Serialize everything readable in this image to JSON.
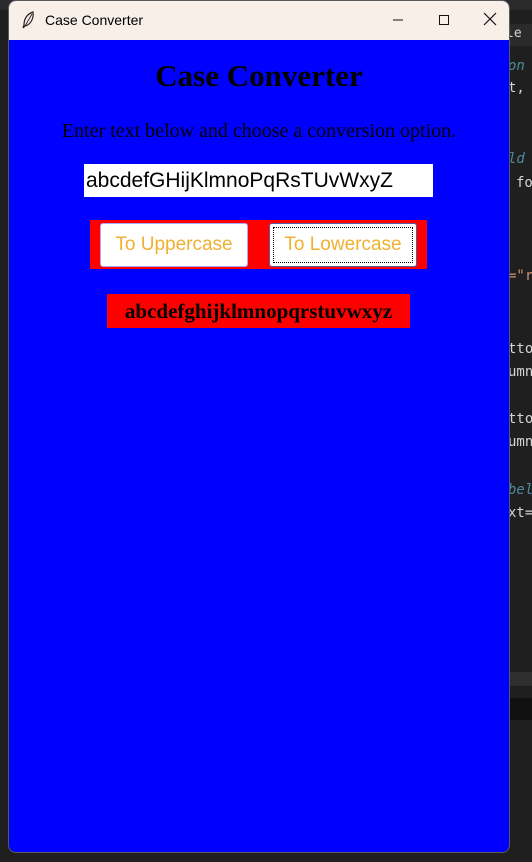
{
  "window": {
    "title": "Case Converter",
    "icon": "feather-icon",
    "controls": [
      "minimize-icon",
      "maximize-icon",
      "close-icon"
    ]
  },
  "app": {
    "heading": "Case Converter",
    "instructions": "Enter text below and choose a conversion option.",
    "input_value": "abcdefGHijKlmnoPqRsTUvWxyZ",
    "upper_button": "To Uppercase",
    "lower_button": "To Lowercase",
    "result": "abcdefghijklmnopqrstuvwxyz"
  },
  "background_editor": {
    "tab_text": "le",
    "lines": [
      {
        "text": "on",
        "style": "comment"
      },
      {
        "text": "t,",
        "style": "code"
      },
      {
        "text": "ld",
        "style": "comment"
      },
      {
        "text": "fo",
        "style": "code"
      },
      {
        "text": "=\"r",
        "style": "string"
      },
      {
        "text": "tto",
        "style": "code"
      },
      {
        "text": "umn",
        "style": "code"
      },
      {
        "text": "tto",
        "style": "code"
      },
      {
        "text": "umn",
        "style": "code"
      },
      {
        "text": "bel",
        "style": "comment"
      },
      {
        "text": "xt=",
        "style": "code"
      }
    ]
  },
  "colors": {
    "window_bg": "#0000ff",
    "button_frame": "#ff0000",
    "button_text": "#f0b030",
    "result_bg": "#ff0000",
    "titlebar_bg": "#f9efe9"
  }
}
